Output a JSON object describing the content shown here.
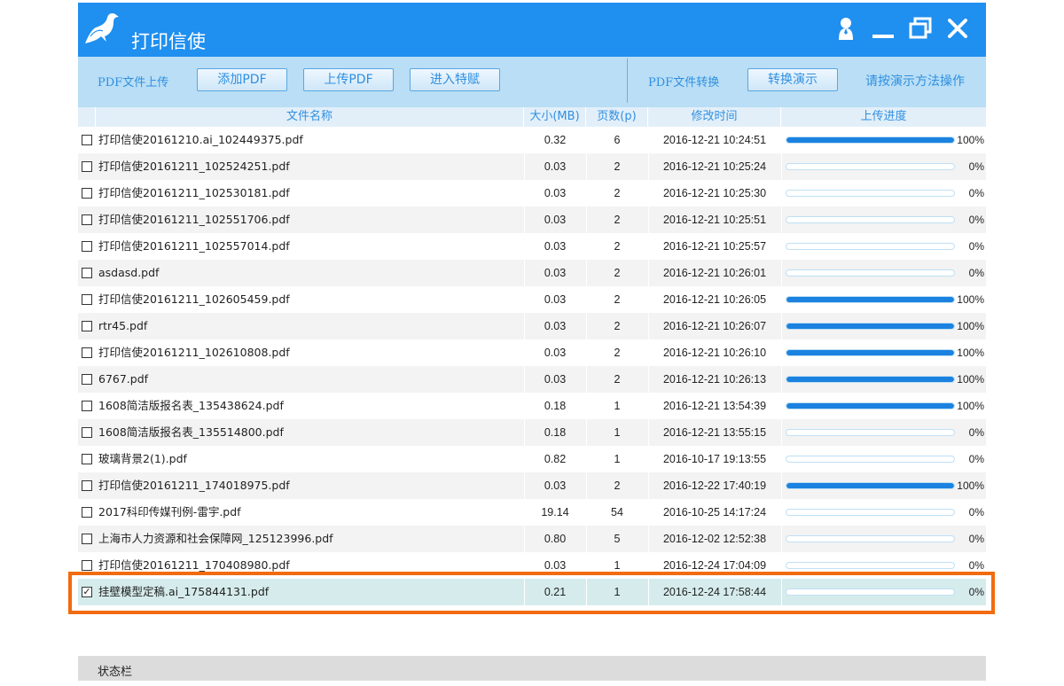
{
  "app": {
    "title": "打印信使"
  },
  "titlebar_icons": {
    "user": "person-icon",
    "minimize": "minimize-icon",
    "restore": "restore-icon",
    "close": "close-icon"
  },
  "toolbar": {
    "upload_label": "PDF文件上传",
    "add_pdf": "添加PDF",
    "upload_pdf": "上传PDF",
    "enter_special": "进入特赋",
    "convert_label": "PDF文件转换",
    "convert_demo": "转换演示",
    "hint": "请按演示方法操作"
  },
  "table": {
    "headers": {
      "name": "文件名称",
      "size": "大小(MB)",
      "pages": "页数(p)",
      "time": "修改时间",
      "progress": "上传进度"
    },
    "rows": [
      {
        "name": "打印信使20161210.ai_102449375.pdf",
        "size": "0.32",
        "pages": "6",
        "time": "2016-12-21 10:24:51",
        "progress": 1.0,
        "pct": "100%",
        "checked": false
      },
      {
        "name": "打印信使20161211_102524251.pdf",
        "size": "0.03",
        "pages": "2",
        "time": "2016-12-21 10:25:24",
        "progress": 0,
        "pct": "0%",
        "checked": false
      },
      {
        "name": "打印信使20161211_102530181.pdf",
        "size": "0.03",
        "pages": "2",
        "time": "2016-12-21 10:25:30",
        "progress": 0,
        "pct": "0%",
        "checked": false
      },
      {
        "name": "打印信使20161211_102551706.pdf",
        "size": "0.03",
        "pages": "2",
        "time": "2016-12-21 10:25:51",
        "progress": 0,
        "pct": "0%",
        "checked": false
      },
      {
        "name": "打印信使20161211_102557014.pdf",
        "size": "0.03",
        "pages": "2",
        "time": "2016-12-21 10:25:57",
        "progress": 0,
        "pct": "0%",
        "checked": false
      },
      {
        "name": "asdasd.pdf",
        "size": "0.03",
        "pages": "2",
        "time": "2016-12-21 10:26:01",
        "progress": 0,
        "pct": "0%",
        "checked": false
      },
      {
        "name": "打印信使20161211_102605459.pdf",
        "size": "0.03",
        "pages": "2",
        "time": "2016-12-21 10:26:05",
        "progress": 1.0,
        "pct": "100%",
        "checked": false
      },
      {
        "name": "rtr45.pdf",
        "size": "0.03",
        "pages": "2",
        "time": "2016-12-21 10:26:07",
        "progress": 1.0,
        "pct": "100%",
        "checked": false
      },
      {
        "name": "打印信使20161211_102610808.pdf",
        "size": "0.03",
        "pages": "2",
        "time": "2016-12-21 10:26:10",
        "progress": 1.0,
        "pct": "100%",
        "checked": false
      },
      {
        "name": "6767.pdf",
        "size": "0.03",
        "pages": "2",
        "time": "2016-12-21 10:26:13",
        "progress": 1.0,
        "pct": "100%",
        "checked": false
      },
      {
        "name": "1608简洁版报名表_135438624.pdf",
        "size": "0.18",
        "pages": "1",
        "time": "2016-12-21 13:54:39",
        "progress": 1.0,
        "pct": "100%",
        "checked": false
      },
      {
        "name": "1608简洁版报名表_135514800.pdf",
        "size": "0.18",
        "pages": "1",
        "time": "2016-12-21 13:55:15",
        "progress": 0,
        "pct": "0%",
        "checked": false
      },
      {
        "name": "玻璃背景2(1).pdf",
        "size": "0.82",
        "pages": "1",
        "time": "2016-10-17 19:13:55",
        "progress": 0,
        "pct": "0%",
        "checked": false
      },
      {
        "name": "打印信使20161211_174018975.pdf",
        "size": "0.03",
        "pages": "2",
        "time": "2016-12-22 17:40:19",
        "progress": 1.0,
        "pct": "100%",
        "checked": false
      },
      {
        "name": "2017科印传媒刊例-雷宇.pdf",
        "size": "19.14",
        "pages": "54",
        "time": "2016-10-25 14:17:24",
        "progress": 0,
        "pct": "0%",
        "checked": false
      },
      {
        "name": "上海市人力资源和社会保障网_125123996.pdf",
        "size": "0.80",
        "pages": "5",
        "time": "2016-12-02 12:52:38",
        "progress": 0,
        "pct": "0%",
        "checked": false
      },
      {
        "name": "打印信使20161211_170408980.pdf",
        "size": "0.03",
        "pages": "1",
        "time": "2016-12-24 17:04:09",
        "progress": 0,
        "pct": "0%",
        "checked": false
      },
      {
        "name": "挂壁模型定稿.ai_175844131.pdf",
        "size": "0.21",
        "pages": "1",
        "time": "2016-12-24 17:58:44",
        "progress": 0,
        "pct": "0%",
        "checked": true
      }
    ]
  },
  "status": {
    "text": "状态栏"
  },
  "colors": {
    "titlebar": "#1f8ff0",
    "toolbar": "#b9def5",
    "accent": "#2f8fe0",
    "progress": "#1b82e0",
    "highlight": "#f26b0f"
  }
}
